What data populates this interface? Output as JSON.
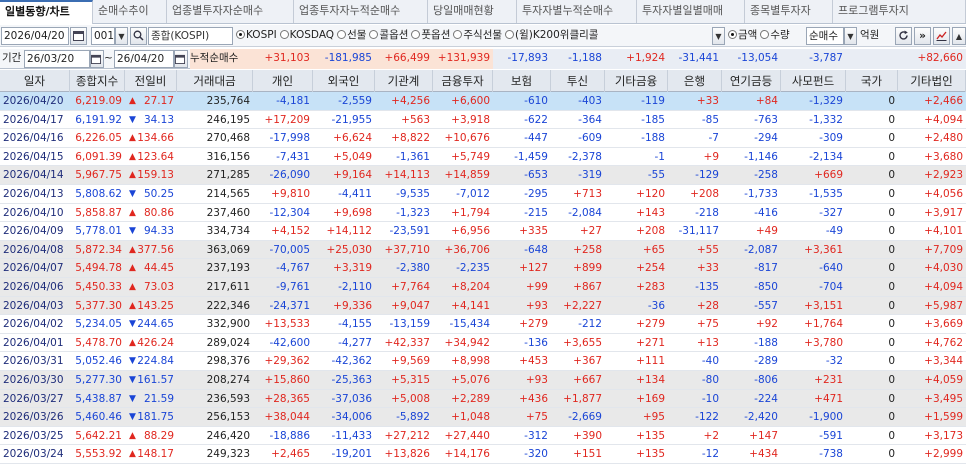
{
  "tabs": [
    "일별동향/차트",
    "순매수추이",
    "업종별투자자순매수",
    "업종투자자누적순매수",
    "당일매매현황",
    "투자자별누적순매수",
    "투자자별일별매매",
    "종목별투자자",
    "프로그램투자지"
  ],
  "toolbar": {
    "date": "2026/04/20",
    "code": "001",
    "index_name": "종합(KOSPI)",
    "markets": [
      {
        "label": "KOSPI",
        "on": true
      },
      {
        "label": "KOSDAQ",
        "on": false
      },
      {
        "label": "선물",
        "on": false
      },
      {
        "label": "콜옵션",
        "on": false
      },
      {
        "label": "풋옵션",
        "on": false
      },
      {
        "label": "주식선물",
        "on": false
      },
      {
        "label": "(윌)K200위클리콜",
        "on": false
      }
    ],
    "units": [
      {
        "label": "금액",
        "on": true
      },
      {
        "label": "수량",
        "on": false
      }
    ],
    "net_type": "순매수",
    "unit_label": "억원"
  },
  "period": {
    "label": "기간",
    "from": "26/03/20",
    "sep": "~",
    "to": "26/04/20",
    "cum_label": "누적순매수",
    "totals": [
      "+31,103",
      "-181,985",
      "+66,499",
      "+131,939",
      "-17,893",
      "-1,188",
      "+1,924",
      "-31,441",
      "-13,054",
      "-3,787",
      "",
      "+82,660"
    ]
  },
  "columns": [
    "일자",
    "종합지수",
    "전일비",
    "거래대금",
    "개인",
    "외국인",
    "기관계",
    "금융투자",
    "보험",
    "투신",
    "기타금융",
    "은행",
    "연기금등",
    "사모펀드",
    "국가",
    "기타법인"
  ],
  "rows": [
    [
      "2026/04/20",
      "6,219.09",
      "up",
      "27.17",
      "235,764",
      "-4,181",
      "-2,559",
      "+4,256",
      "+6,600",
      "-610",
      "-403",
      "-119",
      "+33",
      "+84",
      "-1,329",
      "0",
      "+2,466"
    ],
    [
      "2026/04/17",
      "6,191.92",
      "dn",
      "34.13",
      "246,195",
      "+17,209",
      "-21,955",
      "+563",
      "+3,918",
      "-622",
      "-364",
      "-185",
      "-85",
      "-763",
      "-1,332",
      "0",
      "+4,094"
    ],
    [
      "2026/04/16",
      "6,226.05",
      "up",
      "134.66",
      "270,468",
      "-17,998",
      "+6,624",
      "+8,822",
      "+10,676",
      "-447",
      "-609",
      "-188",
      "-7",
      "-294",
      "-309",
      "0",
      "+2,480"
    ],
    [
      "2026/04/15",
      "6,091.39",
      "up",
      "123.64",
      "316,156",
      "-7,431",
      "+5,049",
      "-1,361",
      "+5,749",
      "-1,459",
      "-2,378",
      "-1",
      "+9",
      "-1,146",
      "-2,134",
      "0",
      "+3,680"
    ],
    [
      "2026/04/14",
      "5,967.75",
      "up",
      "159.13",
      "271,285",
      "-26,090",
      "+9,164",
      "+14,113",
      "+14,859",
      "-653",
      "-319",
      "-55",
      "-129",
      "-258",
      "+669",
      "0",
      "+2,923"
    ],
    [
      "2026/04/13",
      "5,808.62",
      "dn",
      "50.25",
      "214,565",
      "+9,810",
      "-4,411",
      "-9,535",
      "-7,012",
      "-295",
      "+713",
      "+120",
      "+208",
      "-1,733",
      "-1,535",
      "0",
      "+4,056"
    ],
    [
      "2026/04/10",
      "5,858.87",
      "up",
      "80.86",
      "237,460",
      "-12,304",
      "+9,698",
      "-1,323",
      "+1,794",
      "-215",
      "-2,084",
      "+143",
      "-218",
      "-416",
      "-327",
      "0",
      "+3,917"
    ],
    [
      "2026/04/09",
      "5,778.01",
      "dn",
      "94.33",
      "334,734",
      "+4,152",
      "+14,112",
      "-23,591",
      "+6,956",
      "+335",
      "+27",
      "+208",
      "-31,117",
      "+49",
      "-49",
      "0",
      "+4,101"
    ],
    [
      "2026/04/08",
      "5,872.34",
      "up",
      "377.56",
      "363,069",
      "-70,005",
      "+25,030",
      "+37,710",
      "+36,706",
      "-648",
      "+258",
      "+65",
      "+55",
      "-2,087",
      "+3,361",
      "0",
      "+7,709"
    ],
    [
      "2026/04/07",
      "5,494.78",
      "up",
      "44.45",
      "237,193",
      "-4,767",
      "+3,319",
      "-2,380",
      "-2,235",
      "+127",
      "+899",
      "+254",
      "+33",
      "-817",
      "-640",
      "0",
      "+4,030"
    ],
    [
      "2026/04/06",
      "5,450.33",
      "up",
      "73.03",
      "217,611",
      "-9,761",
      "-2,110",
      "+7,764",
      "+8,204",
      "+99",
      "+867",
      "+283",
      "-135",
      "-850",
      "-704",
      "0",
      "+4,094"
    ],
    [
      "2026/04/03",
      "5,377.30",
      "up",
      "143.25",
      "222,346",
      "-24,371",
      "+9,336",
      "+9,047",
      "+4,141",
      "+93",
      "+2,227",
      "-36",
      "+28",
      "-557",
      "+3,151",
      "0",
      "+5,987"
    ],
    [
      "2026/04/02",
      "5,234.05",
      "dn",
      "244.65",
      "332,900",
      "+13,533",
      "-4,155",
      "-13,159",
      "-15,434",
      "+279",
      "-212",
      "+279",
      "+75",
      "+92",
      "+1,764",
      "0",
      "+3,669"
    ],
    [
      "2026/04/01",
      "5,478.70",
      "up",
      "426.24",
      "289,024",
      "-42,600",
      "-4,277",
      "+42,337",
      "+34,942",
      "-136",
      "+3,655",
      "+271",
      "+13",
      "-188",
      "+3,780",
      "0",
      "+4,762"
    ],
    [
      "2026/03/31",
      "5,052.46",
      "dn",
      "224.84",
      "298,376",
      "+29,362",
      "-42,362",
      "+9,569",
      "+8,998",
      "+453",
      "+367",
      "+111",
      "-40",
      "-289",
      "-32",
      "0",
      "+3,344"
    ],
    [
      "2026/03/30",
      "5,277.30",
      "dn",
      "161.57",
      "208,274",
      "+15,860",
      "-25,363",
      "+5,315",
      "+5,076",
      "+93",
      "+667",
      "+134",
      "-80",
      "-806",
      "+231",
      "0",
      "+4,059"
    ],
    [
      "2026/03/27",
      "5,438.87",
      "dn",
      "21.59",
      "236,593",
      "+28,365",
      "-37,036",
      "+5,008",
      "+2,289",
      "+436",
      "+1,877",
      "+169",
      "-10",
      "-224",
      "+471",
      "0",
      "+3,495"
    ],
    [
      "2026/03/26",
      "5,460.46",
      "dn",
      "181.75",
      "256,153",
      "+38,044",
      "-34,006",
      "-5,892",
      "+1,048",
      "+75",
      "-2,669",
      "+95",
      "-122",
      "-2,420",
      "-1,900",
      "0",
      "+1,599"
    ],
    [
      "2026/03/25",
      "5,642.21",
      "up",
      "88.29",
      "246,420",
      "-18,886",
      "-11,433",
      "+27,212",
      "+27,440",
      "-312",
      "+390",
      "+135",
      "+2",
      "+147",
      "-591",
      "0",
      "+3,173"
    ],
    [
      "2026/03/24",
      "5,553.92",
      "up",
      "148.17",
      "249,323",
      "+2,465",
      "-19,201",
      "+13,826",
      "+14,176",
      "-320",
      "+151",
      "+135",
      "-12",
      "+434",
      "-738",
      "0",
      "+2,999"
    ]
  ],
  "colors": {
    "positive": "#e0271f",
    "negative": "#1a45d6",
    "selected_row": "#c7e2f7",
    "shaded_row": "#e9e9e9",
    "header_bg": "#e3e8ef"
  },
  "icons": [
    "calendar-icon",
    "search-icon",
    "refresh-icon",
    "fast-forward-icon",
    "chart-icon",
    "scroll-arrow-icon"
  ]
}
